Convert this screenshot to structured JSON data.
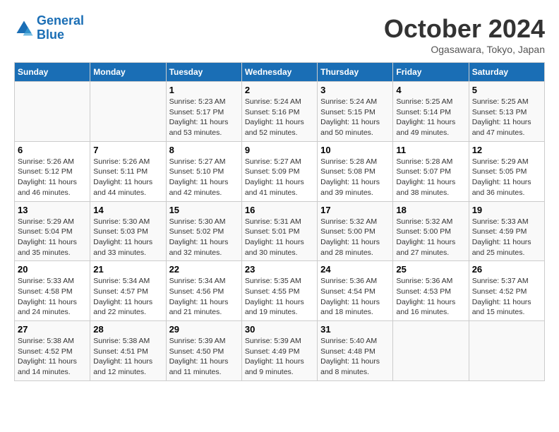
{
  "header": {
    "logo_line1": "General",
    "logo_line2": "Blue",
    "title": "October 2024",
    "subtitle": "Ogasawara, Tokyo, Japan"
  },
  "weekdays": [
    "Sunday",
    "Monday",
    "Tuesday",
    "Wednesday",
    "Thursday",
    "Friday",
    "Saturday"
  ],
  "weeks": [
    [
      {
        "day": "",
        "info": ""
      },
      {
        "day": "",
        "info": ""
      },
      {
        "day": "1",
        "info": "Sunrise: 5:23 AM\nSunset: 5:17 PM\nDaylight: 11 hours and 53 minutes."
      },
      {
        "day": "2",
        "info": "Sunrise: 5:24 AM\nSunset: 5:16 PM\nDaylight: 11 hours and 52 minutes."
      },
      {
        "day": "3",
        "info": "Sunrise: 5:24 AM\nSunset: 5:15 PM\nDaylight: 11 hours and 50 minutes."
      },
      {
        "day": "4",
        "info": "Sunrise: 5:25 AM\nSunset: 5:14 PM\nDaylight: 11 hours and 49 minutes."
      },
      {
        "day": "5",
        "info": "Sunrise: 5:25 AM\nSunset: 5:13 PM\nDaylight: 11 hours and 47 minutes."
      }
    ],
    [
      {
        "day": "6",
        "info": "Sunrise: 5:26 AM\nSunset: 5:12 PM\nDaylight: 11 hours and 46 minutes."
      },
      {
        "day": "7",
        "info": "Sunrise: 5:26 AM\nSunset: 5:11 PM\nDaylight: 11 hours and 44 minutes."
      },
      {
        "day": "8",
        "info": "Sunrise: 5:27 AM\nSunset: 5:10 PM\nDaylight: 11 hours and 42 minutes."
      },
      {
        "day": "9",
        "info": "Sunrise: 5:27 AM\nSunset: 5:09 PM\nDaylight: 11 hours and 41 minutes."
      },
      {
        "day": "10",
        "info": "Sunrise: 5:28 AM\nSunset: 5:08 PM\nDaylight: 11 hours and 39 minutes."
      },
      {
        "day": "11",
        "info": "Sunrise: 5:28 AM\nSunset: 5:07 PM\nDaylight: 11 hours and 38 minutes."
      },
      {
        "day": "12",
        "info": "Sunrise: 5:29 AM\nSunset: 5:05 PM\nDaylight: 11 hours and 36 minutes."
      }
    ],
    [
      {
        "day": "13",
        "info": "Sunrise: 5:29 AM\nSunset: 5:04 PM\nDaylight: 11 hours and 35 minutes."
      },
      {
        "day": "14",
        "info": "Sunrise: 5:30 AM\nSunset: 5:03 PM\nDaylight: 11 hours and 33 minutes."
      },
      {
        "day": "15",
        "info": "Sunrise: 5:30 AM\nSunset: 5:02 PM\nDaylight: 11 hours and 32 minutes."
      },
      {
        "day": "16",
        "info": "Sunrise: 5:31 AM\nSunset: 5:01 PM\nDaylight: 11 hours and 30 minutes."
      },
      {
        "day": "17",
        "info": "Sunrise: 5:32 AM\nSunset: 5:00 PM\nDaylight: 11 hours and 28 minutes."
      },
      {
        "day": "18",
        "info": "Sunrise: 5:32 AM\nSunset: 5:00 PM\nDaylight: 11 hours and 27 minutes."
      },
      {
        "day": "19",
        "info": "Sunrise: 5:33 AM\nSunset: 4:59 PM\nDaylight: 11 hours and 25 minutes."
      }
    ],
    [
      {
        "day": "20",
        "info": "Sunrise: 5:33 AM\nSunset: 4:58 PM\nDaylight: 11 hours and 24 minutes."
      },
      {
        "day": "21",
        "info": "Sunrise: 5:34 AM\nSunset: 4:57 PM\nDaylight: 11 hours and 22 minutes."
      },
      {
        "day": "22",
        "info": "Sunrise: 5:34 AM\nSunset: 4:56 PM\nDaylight: 11 hours and 21 minutes."
      },
      {
        "day": "23",
        "info": "Sunrise: 5:35 AM\nSunset: 4:55 PM\nDaylight: 11 hours and 19 minutes."
      },
      {
        "day": "24",
        "info": "Sunrise: 5:36 AM\nSunset: 4:54 PM\nDaylight: 11 hours and 18 minutes."
      },
      {
        "day": "25",
        "info": "Sunrise: 5:36 AM\nSunset: 4:53 PM\nDaylight: 11 hours and 16 minutes."
      },
      {
        "day": "26",
        "info": "Sunrise: 5:37 AM\nSunset: 4:52 PM\nDaylight: 11 hours and 15 minutes."
      }
    ],
    [
      {
        "day": "27",
        "info": "Sunrise: 5:38 AM\nSunset: 4:52 PM\nDaylight: 11 hours and 14 minutes."
      },
      {
        "day": "28",
        "info": "Sunrise: 5:38 AM\nSunset: 4:51 PM\nDaylight: 11 hours and 12 minutes."
      },
      {
        "day": "29",
        "info": "Sunrise: 5:39 AM\nSunset: 4:50 PM\nDaylight: 11 hours and 11 minutes."
      },
      {
        "day": "30",
        "info": "Sunrise: 5:39 AM\nSunset: 4:49 PM\nDaylight: 11 hours and 9 minutes."
      },
      {
        "day": "31",
        "info": "Sunrise: 5:40 AM\nSunset: 4:48 PM\nDaylight: 11 hours and 8 minutes."
      },
      {
        "day": "",
        "info": ""
      },
      {
        "day": "",
        "info": ""
      }
    ]
  ]
}
